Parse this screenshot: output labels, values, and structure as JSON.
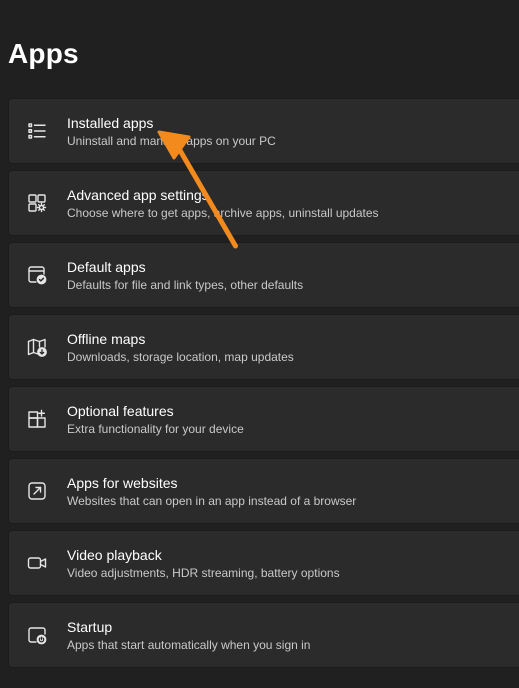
{
  "page": {
    "title": "Apps"
  },
  "items": [
    {
      "title": "Installed apps",
      "subtitle": "Uninstall and manage apps on your PC",
      "icon": "list-icon"
    },
    {
      "title": "Advanced app settings",
      "subtitle": "Choose where to get apps, archive apps, uninstall updates",
      "icon": "app-settings-icon"
    },
    {
      "title": "Default apps",
      "subtitle": "Defaults for file and link types, other defaults",
      "icon": "default-apps-icon"
    },
    {
      "title": "Offline maps",
      "subtitle": "Downloads, storage location, map updates",
      "icon": "map-download-icon"
    },
    {
      "title": "Optional features",
      "subtitle": "Extra functionality for your device",
      "icon": "add-grid-icon"
    },
    {
      "title": "Apps for websites",
      "subtitle": "Websites that can open in an app instead of a browser",
      "icon": "open-external-icon"
    },
    {
      "title": "Video playback",
      "subtitle": "Video adjustments, HDR streaming, battery options",
      "icon": "video-camera-icon"
    },
    {
      "title": "Startup",
      "subtitle": "Apps that start automatically when you sign in",
      "icon": "startup-icon"
    }
  ],
  "annotation": {
    "arrow_color": "#f28a1e"
  }
}
